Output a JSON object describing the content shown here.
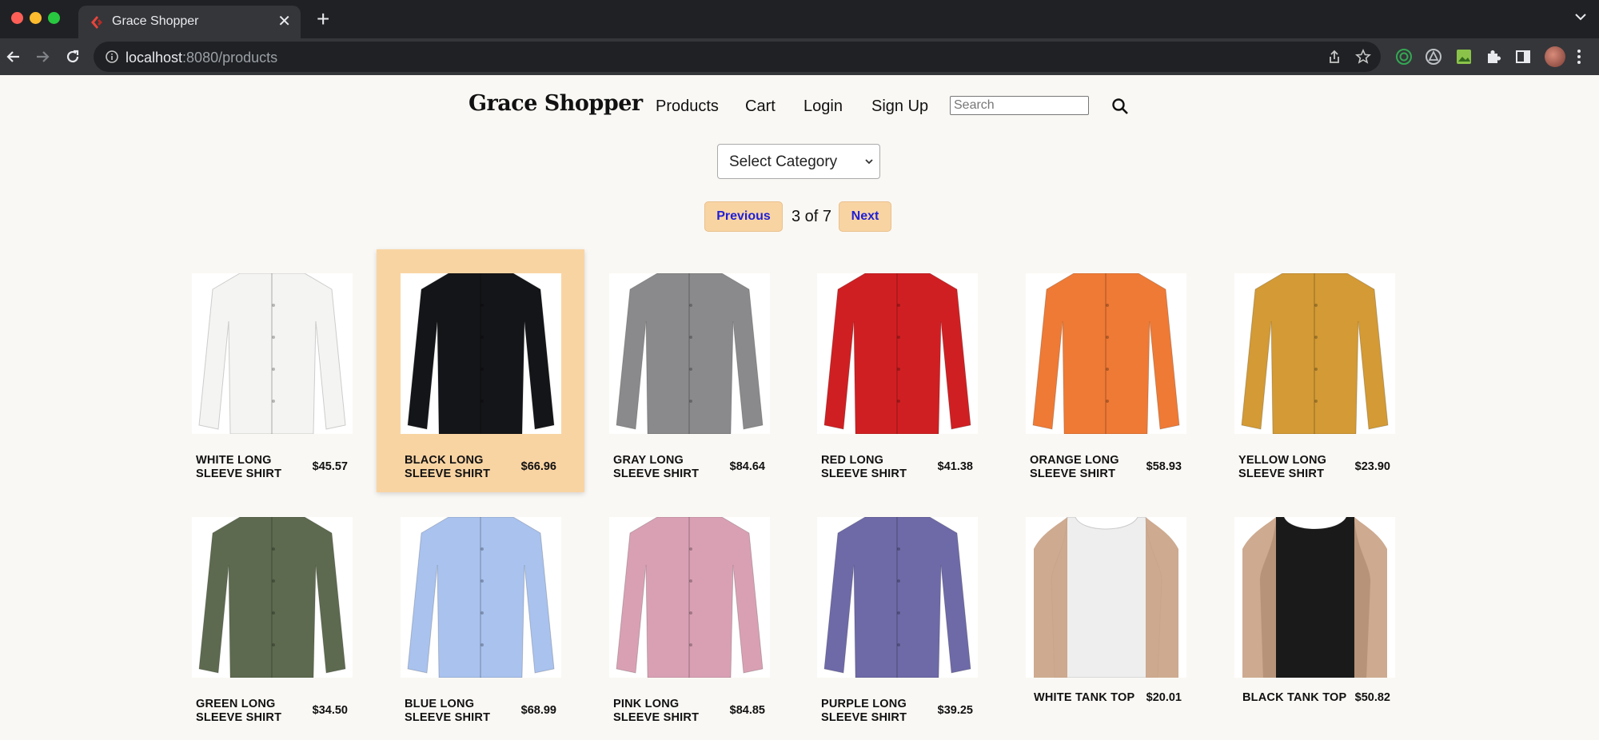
{
  "browser": {
    "tab_title": "Grace Shopper",
    "url_host": "localhost",
    "url_rest": ":8080/products"
  },
  "header": {
    "brand": "Grace Shopper",
    "nav": [
      "Products",
      "Cart",
      "Login",
      "Sign Up"
    ],
    "search_placeholder": "Search"
  },
  "filter": {
    "category_selected": "Select Category"
  },
  "pagination": {
    "previous_label": "Previous",
    "next_label": "Next",
    "status": "3 of 7"
  },
  "products": [
    {
      "name": "White Long Sleeve Shirt",
      "price": "$45.57",
      "color": "#f4f4f2",
      "selected": false
    },
    {
      "name": "Black Long Sleeve Shirt",
      "price": "$66.96",
      "color": "#141518",
      "selected": true
    },
    {
      "name": "Gray Long Sleeve Shirt",
      "price": "$84.64",
      "color": "#8a8a8c",
      "selected": false
    },
    {
      "name": "Red Long Sleeve Shirt",
      "price": "$41.38",
      "color": "#d01f22",
      "selected": false
    },
    {
      "name": "Orange Long Sleeve Shirt",
      "price": "$58.93",
      "color": "#ef7a35",
      "selected": false
    },
    {
      "name": "Yellow Long Sleeve Shirt",
      "price": "$23.90",
      "color": "#d39a35",
      "selected": false
    },
    {
      "name": "Green Long Sleeve Shirt",
      "price": "$34.50",
      "color": "#5d6a4f",
      "selected": false
    },
    {
      "name": "Blue Long Sleeve Shirt",
      "price": "$68.99",
      "color": "#a9c2ee",
      "selected": false
    },
    {
      "name": "Pink Long Sleeve Shirt",
      "price": "$84.85",
      "color": "#d9a0b4",
      "selected": false
    },
    {
      "name": "Purple Long Sleeve Shirt",
      "price": "$39.25",
      "color": "#6e6aa8",
      "selected": false
    },
    {
      "name": "White Tank Top",
      "price": "$20.01",
      "color": "#eeeeee",
      "selected": false
    },
    {
      "name": "Black Tank Top",
      "price": "$50.82",
      "color": "#1a1a1a",
      "selected": false
    }
  ]
}
